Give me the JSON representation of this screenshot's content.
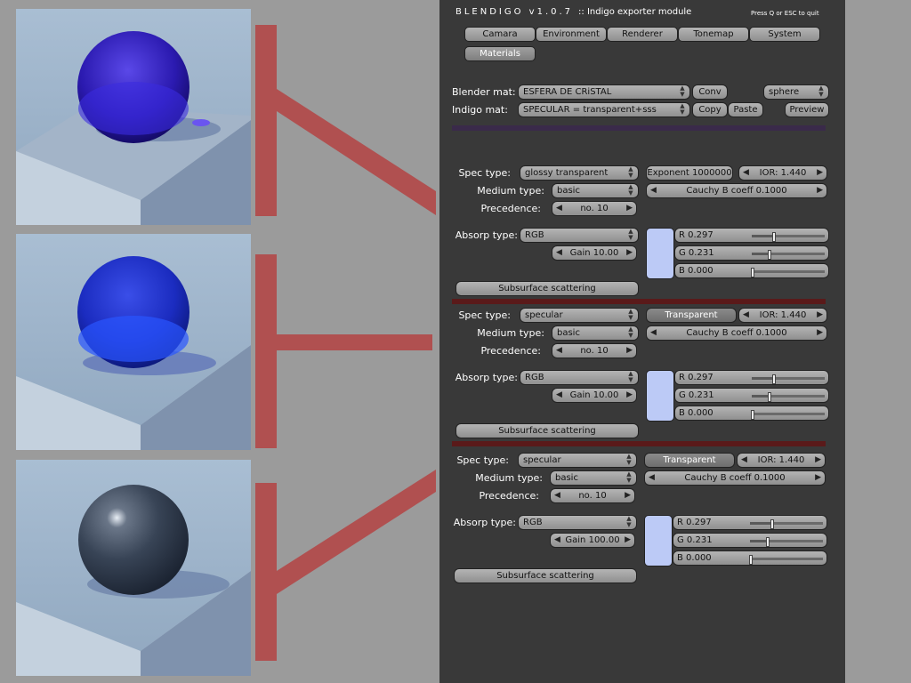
{
  "window": {
    "title": "BLENDIGO v1.0.7",
    "subtitle": ":: Indigo exporter module",
    "quit_hint": "Press Q or ESC to quit"
  },
  "tabs": [
    {
      "label": "Camara",
      "active": false
    },
    {
      "label": "Environment",
      "active": false
    },
    {
      "label": "Renderer",
      "active": false
    },
    {
      "label": "Tonemap",
      "active": false
    },
    {
      "label": "System",
      "active": false
    },
    {
      "label": "Materials",
      "active": true
    }
  ],
  "material": {
    "blender_label": "Blender mat:",
    "blender_value": "ESFERA DE CRiSTAL",
    "conv_label": "Conv",
    "object_value": "sphere",
    "indigo_label": "Indigo mat:",
    "indigo_value": "SPECULAR = transparent+sss",
    "copy_label": "Copy",
    "paste_label": "Paste",
    "preview_label": "Preview"
  },
  "sections": [
    {
      "spec_label": "Spec type:",
      "spec_value": "glossy transparent",
      "exponent_value": "Exponent 1000000",
      "ior_value": "IOR: 1.440",
      "medium_label": "Medium type:",
      "medium_value": "basic",
      "cauchy_value": "Cauchy B coeff 0.1000",
      "precedence_label": "Precedence:",
      "precedence_value": "no. 10",
      "absorp_label": "Absorp type:",
      "absorp_value": "RGB",
      "gain_value": "Gain 10.00",
      "r_label": "R 0.297",
      "g_label": "G 0.231",
      "b_label": "B 0.000",
      "r": 0.297,
      "g": 0.231,
      "b": 0.0,
      "sss_label": "Subsurface scattering",
      "divider_color": "#3a2a4a"
    },
    {
      "spec_label": "Spec type:",
      "spec_value": "specular",
      "exponent_value": "Transparent",
      "ior_value": "IOR: 1.440",
      "medium_label": "Medium type:",
      "medium_value": "basic",
      "cauchy_value": "Cauchy B coeff 0.1000",
      "precedence_label": "Precedence:",
      "precedence_value": "no. 10",
      "absorp_label": "Absorp type:",
      "absorp_value": "RGB",
      "gain_value": "Gain 10.00",
      "r_label": "R 0.297",
      "g_label": "G 0.231",
      "b_label": "B 0.000",
      "r": 0.297,
      "g": 0.231,
      "b": 0.0,
      "sss_label": "Subsurface scattering",
      "divider_color": "#5a1a1a"
    },
    {
      "spec_label": "Spec type:",
      "spec_value": "specular",
      "exponent_value": "Transparent",
      "ior_value": "IOR: 1.440",
      "medium_label": "Medium type:",
      "medium_value": "basic",
      "cauchy_value": "Cauchy B coeff 0.1000",
      "precedence_label": "Precedence:",
      "precedence_value": "no. 10",
      "absorp_label": "Absorp type:",
      "absorp_value": "RGB",
      "gain_value": "Gain 100.00",
      "r_label": "R 0.297",
      "g_label": "G 0.231",
      "b_label": "B 0.000",
      "r": 0.297,
      "g": 0.231,
      "b": 0.0,
      "sss_label": "Subsurface scattering",
      "divider_color": "#5a1a1a"
    }
  ],
  "colors": {
    "panel_bg": "#393939",
    "page_bg": "#9b9b9b",
    "connector": "#b05050",
    "swatch": "#bccaf6"
  }
}
